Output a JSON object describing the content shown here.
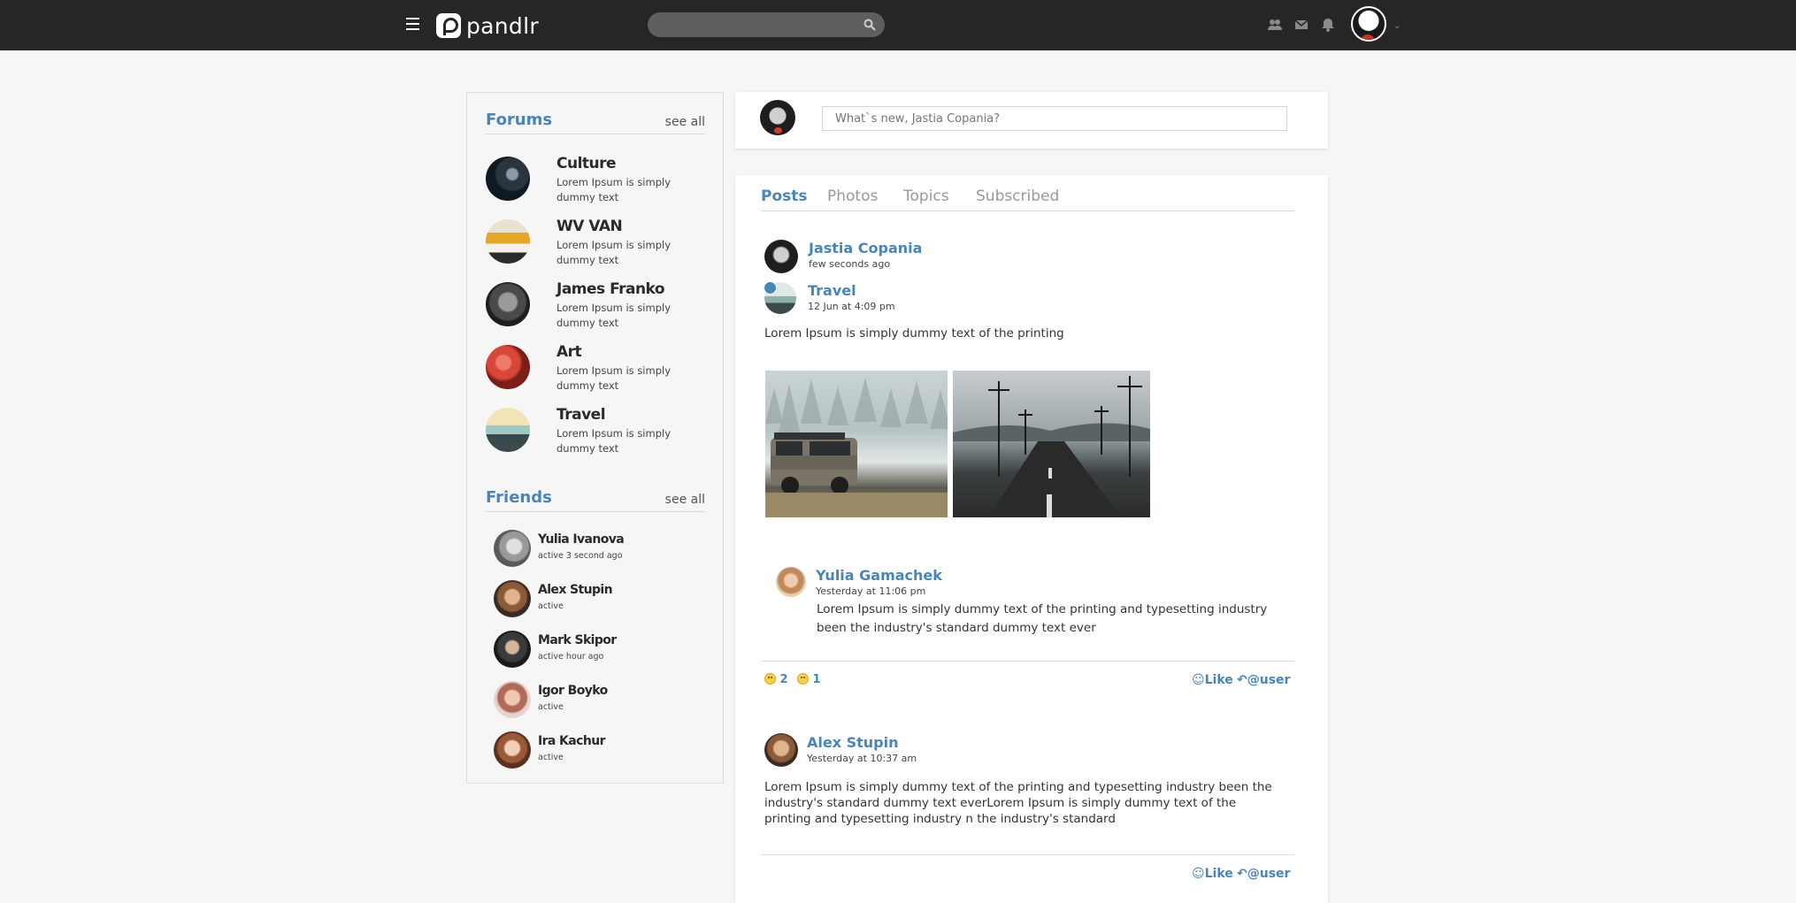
{
  "app": {
    "brand": "pandlr"
  },
  "colors": {
    "accent": "#4a86b5",
    "topbar": "#262626"
  },
  "header": {
    "menu_icon": "hamburger-icon",
    "search_icon": "search-icon",
    "icons": [
      "friends-icon",
      "mail-icon",
      "bell-icon"
    ]
  },
  "sidebar": {
    "forums": {
      "title": "Forums",
      "see_all": "see all",
      "items": [
        {
          "name": "Culture",
          "desc": "Lorem Ipsum is simply dummy text"
        },
        {
          "name": "WV VAN",
          "desc": "Lorem Ipsum is simply dummy text"
        },
        {
          "name": "James Franko",
          "desc": "Lorem Ipsum is simply dummy text"
        },
        {
          "name": "Art",
          "desc": "Lorem Ipsum is simply dummy text"
        },
        {
          "name": "Travel",
          "desc": "Lorem Ipsum is simply dummy text"
        }
      ]
    },
    "friends": {
      "title": "Friends",
      "see_all": "see all",
      "items": [
        {
          "name": "Yulia Ivanova",
          "status": "active 3 second ago"
        },
        {
          "name": "Alex Stupin",
          "status": "active"
        },
        {
          "name": "Mark Skipor",
          "status": "active hour ago"
        },
        {
          "name": "Igor Boyko",
          "status": "active"
        },
        {
          "name": "Ira Kachur",
          "status": "active"
        }
      ]
    }
  },
  "composer": {
    "placeholder": "What`s new, Jastia Copania?"
  },
  "feed": {
    "tabs": [
      "Posts",
      "Photos",
      "Topics",
      "Subscribed"
    ],
    "post1": {
      "author": "Jastia Copania",
      "time": "few seconds ago",
      "forum": "Travel",
      "forum_time": "12 Jun at 4:09 pm",
      "text": "Lorem Ipsum is simply dummy text of the printing",
      "comment": {
        "author": "Yulia Gamachek",
        "time": "Yesterday at 11:06 pm",
        "text": "Lorem Ipsum is simply dummy text of the printing and typesetting industry been the industry's standard dummy text ever"
      },
      "reactions": [
        {
          "count": "2"
        },
        {
          "count": "1"
        }
      ],
      "like": "Like",
      "reply": "@user"
    },
    "post2": {
      "author": "Alex Stupin",
      "time": "Yesterday at 10:37 am",
      "text": "Lorem Ipsum is simply dummy text of the printing and typesetting industry been the industry's standard dummy text everLorem Ipsum is simply dummy text of the printing and typesetting industry n the industry's standard",
      "like": "Like",
      "reply": "@user"
    }
  }
}
